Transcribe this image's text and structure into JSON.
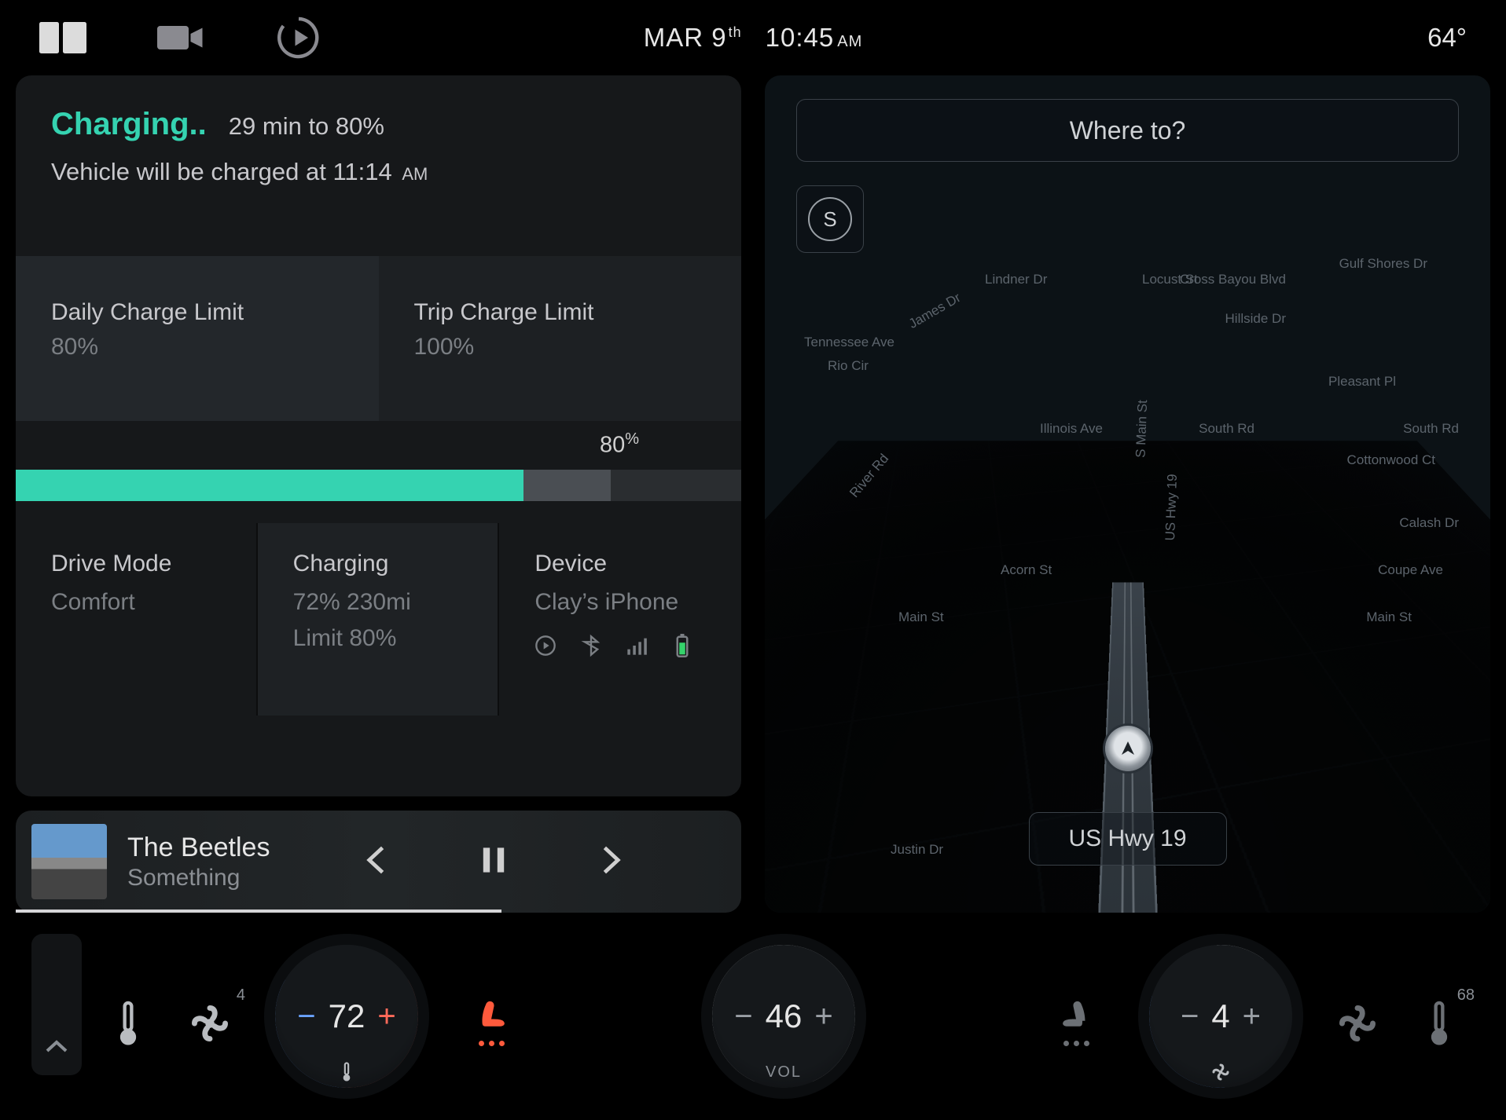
{
  "statusbar": {
    "date_month": "MAR",
    "date_day": "9",
    "date_suffix": "th",
    "time": "10:45",
    "time_ampm": "AM",
    "temp": "64°"
  },
  "charging": {
    "title": "Charging..",
    "to_target": "29 min to 80%",
    "line2_prefix": "Vehicle will be charged at ",
    "line2_time": "11:14",
    "line2_ampm": "AM",
    "limit_daily_label": "Daily Charge Limit",
    "limit_daily_value": "80%",
    "limit_trip_label": "Trip Charge Limit",
    "limit_trip_value": "100%",
    "progress_marker": "80",
    "progress_fill_pct": 70,
    "progress_marker_pct": 82,
    "cells": {
      "drive_label": "Drive Mode",
      "drive_value": "Comfort",
      "chg_label": "Charging",
      "chg_line1": "72%   230mi",
      "chg_line2": "Limit 80%",
      "dev_label": "Device",
      "dev_value": "Clay’s iPhone"
    }
  },
  "media": {
    "artist": "The Beetles",
    "track": "Something"
  },
  "map": {
    "search_placeholder": "Where to?",
    "compass": "S",
    "road_label": "US Hwy 19",
    "streets": {
      "tennessee": "Tennessee Ave",
      "river": "River Rd",
      "acorn": "Acorn St",
      "main_l": "Main St",
      "main_r": "Main St",
      "pleasant": "Pleasant Pl",
      "south": "South Rd",
      "illinois": "Illinois Ave",
      "locust": "Locust St",
      "lindner": "Lindner Dr",
      "james": "James Dr",
      "hillside": "Hillside Dr",
      "crossbayou": "Cross Bayou Blvd",
      "gulfshores": "Gulf Shores Dr",
      "calash": "Calash Dr",
      "coupe": "Coupe Ave",
      "cottonwood": "Cottonwood Ct",
      "ushwy": "US Hwy 19",
      "mainsh": "S Main St",
      "justin": "Justin Dr",
      "rio": "Rio Cir"
    }
  },
  "climate": {
    "fan_left_badge": "4",
    "temp_left": "72",
    "vol": "46",
    "vol_label": "VOL",
    "fan_right_val": "4",
    "temp_right_badge": "68"
  },
  "colors": {
    "accent": "#35d3b1",
    "blue": "#6aa3ff",
    "red": "#ff6a5a"
  }
}
